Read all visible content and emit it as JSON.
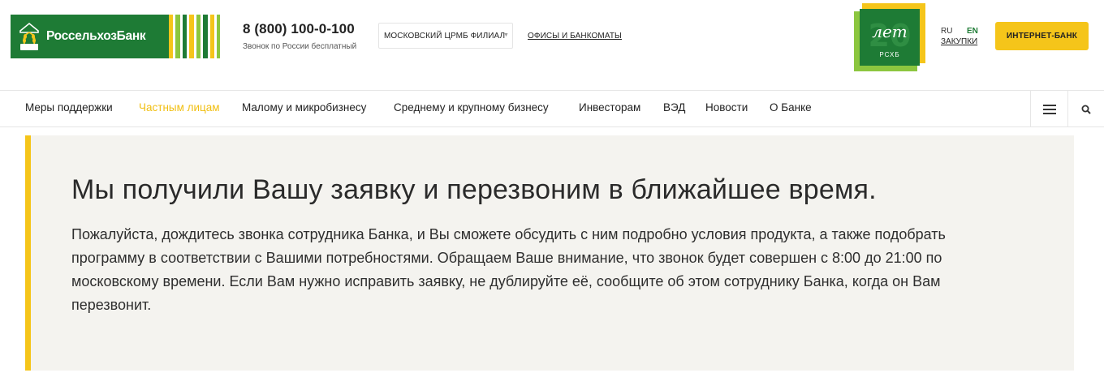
{
  "header": {
    "logo_text": "РоссельхозБанк",
    "logo_emblem_text": "РСХБ",
    "phone": "8 (800) 100-0-100",
    "phone_note": "Звонок по России бесплатный",
    "region": "МОСКОВСКИЙ ЦРМБ ФИЛИАЛ",
    "offices_link": "ОФИСЫ И БАНКОМАТЫ",
    "badge": {
      "number": "20",
      "script": "лет",
      "caption": "РСХБ"
    },
    "lang_ru": "RU",
    "lang_en": "EN",
    "procurement_link": "ЗАКУПКИ",
    "internet_bank_button": "ИНТЕРНЕТ-БАНК"
  },
  "nav": {
    "items": [
      {
        "label": "Меры поддержки",
        "active": false
      },
      {
        "label": "Частным лицам",
        "active": true
      },
      {
        "label": "Малому и микробизнесу",
        "active": false
      },
      {
        "label": "Среднему и крупному бизнесу",
        "active": false
      },
      {
        "label": "Инвесторам",
        "active": false
      },
      {
        "label": "ВЭД",
        "active": false
      },
      {
        "label": "Новости",
        "active": false
      },
      {
        "label": "О Банке",
        "active": false
      }
    ],
    "menu_icon": "hamburger-icon",
    "search_icon": "search-icon"
  },
  "message": {
    "title": "Мы получили Вашу заявку и перезвоним в ближайшее время.",
    "text": "Пожалуйста, дождитесь звонка сотрудника Банка, и Вы сможете обсудить с ним подробно условия продукта, а также подобрать программу в соответствии с Вашими потребностями. Обращаем Ваше внимание, что звонок будет совершен с 8:00 до 21:00 по московскому времени. Если Вам нужно исправить заявку, не дублируйте её, сообщите об этом сотруднику Банка, когда он Вам перезвонит."
  },
  "colors": {
    "brand_green": "#1e7b35",
    "accent_yellow": "#f5c51a",
    "active_nav": "#f1bf12",
    "panel_bg": "#f4f3ef"
  }
}
